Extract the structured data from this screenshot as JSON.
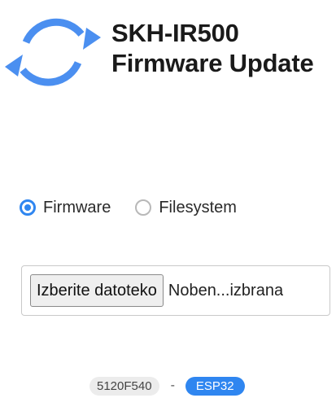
{
  "header": {
    "logo_icon": "sync-arrows-icon",
    "title_line1": "SKH-IR500",
    "title_line2": "Firmware Update"
  },
  "update_type": {
    "selected": "Firmware",
    "options": [
      {
        "label": "Firmware",
        "checked": true
      },
      {
        "label": "Filesystem",
        "checked": false
      }
    ]
  },
  "file_input": {
    "button_label": "Izberite datoteko",
    "status_text": "Noben...izbrana"
  },
  "footer": {
    "version": "5120F540",
    "separator": "-",
    "chip": "ESP32"
  },
  "colors": {
    "accent": "#2f86f0",
    "logo": "#4b8ff0",
    "chip_badge": "#2f86f0",
    "version_badge": "#ececec"
  }
}
